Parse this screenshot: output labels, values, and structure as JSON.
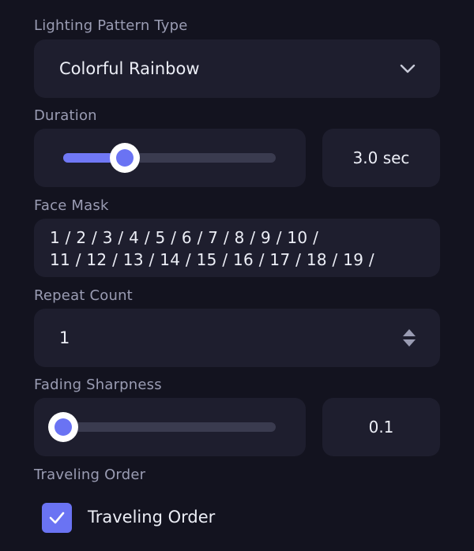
{
  "lighting": {
    "label": "Lighting Pattern Type",
    "value": "Colorful Rainbow",
    "icon": "chevron-down-icon"
  },
  "duration": {
    "label": "Duration",
    "value_text": "3.0 sec",
    "level": 0.29
  },
  "face_mask": {
    "label": "Face Mask",
    "line1": "1 / 2 / 3 / 4 / 5 / 6 / 7 / 8 / 9 / 10 /",
    "line2": "11 / 12 / 13 / 14 / 15 / 16 / 17 / 18 / 19 /"
  },
  "repeat": {
    "label": "Repeat Count",
    "value": "1",
    "icon": "stepper-icon"
  },
  "fading": {
    "label": "Fading Sharpness",
    "value_text": "0.1",
    "level": 0.0
  },
  "traveling": {
    "label": "Traveling Order",
    "checkbox_label": "Traveling Order",
    "checked": true
  },
  "colors": {
    "background": "#13131f",
    "panel": "#1e1e2e",
    "accent": "#6a73f3",
    "label": "#9a9cb3",
    "text": "#eceef6"
  }
}
